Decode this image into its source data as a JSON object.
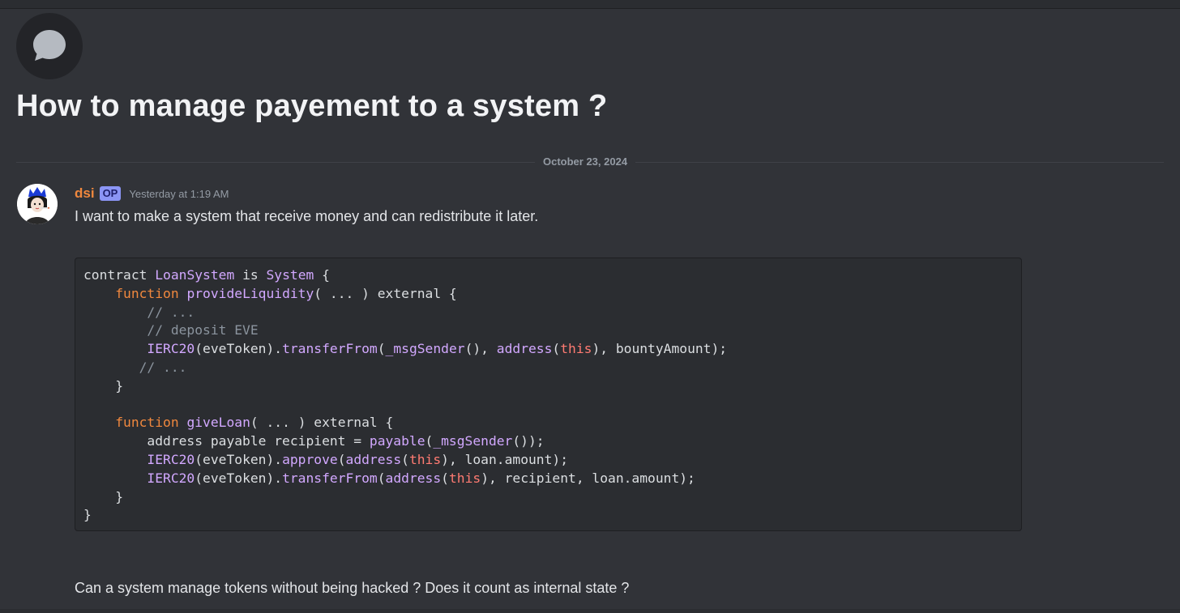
{
  "thread": {
    "title": "How to manage payement to a system ?",
    "icon": "chat-bubble-icon"
  },
  "divider": {
    "date": "October 23, 2024"
  },
  "message": {
    "author": "dsi",
    "badge": "OP",
    "timestamp": "Yesterday at 1:19 AM",
    "text_intro": "I want to make a system that receive money and can redistribute it later.",
    "text_question": "Can a system manage tokens without being hacked ? Does it count as internal state ?"
  },
  "code": {
    "lines": [
      [
        {
          "t": "contract "
        },
        {
          "t": "LoanSystem",
          "c": "fn"
        },
        {
          "t": " is "
        },
        {
          "t": "System",
          "c": "fn"
        },
        {
          "t": " {"
        }
      ],
      [
        {
          "t": "    "
        },
        {
          "t": "function",
          "c": "kw"
        },
        {
          "t": " "
        },
        {
          "t": "provideLiquidity",
          "c": "fn"
        },
        {
          "t": "( ... ) external {"
        }
      ],
      [
        {
          "t": "        "
        },
        {
          "t": "// ...",
          "c": "cm"
        }
      ],
      [
        {
          "t": "        "
        },
        {
          "t": "// deposit EVE",
          "c": "cm"
        }
      ],
      [
        {
          "t": "        "
        },
        {
          "t": "IERC20",
          "c": "fn"
        },
        {
          "t": "(eveToken)."
        },
        {
          "t": "transferFrom",
          "c": "fn"
        },
        {
          "t": "("
        },
        {
          "t": "_msgSender",
          "c": "fn"
        },
        {
          "t": "(), "
        },
        {
          "t": "address",
          "c": "fn"
        },
        {
          "t": "("
        },
        {
          "t": "this",
          "c": "th"
        },
        {
          "t": "), bountyAmount);"
        }
      ],
      [
        {
          "t": "       "
        },
        {
          "t": "// ...",
          "c": "cm"
        }
      ],
      [
        {
          "t": "    }"
        }
      ],
      [
        {
          "t": ""
        }
      ],
      [
        {
          "t": "    "
        },
        {
          "t": "function",
          "c": "kw"
        },
        {
          "t": " "
        },
        {
          "t": "giveLoan",
          "c": "fn"
        },
        {
          "t": "( ... ) external {"
        }
      ],
      [
        {
          "t": "        address payable recipient = "
        },
        {
          "t": "payable",
          "c": "fn"
        },
        {
          "t": "("
        },
        {
          "t": "_msgSender",
          "c": "fn"
        },
        {
          "t": "());"
        }
      ],
      [
        {
          "t": "        "
        },
        {
          "t": "IERC20",
          "c": "fn"
        },
        {
          "t": "(eveToken)."
        },
        {
          "t": "approve",
          "c": "fn"
        },
        {
          "t": "("
        },
        {
          "t": "address",
          "c": "fn"
        },
        {
          "t": "("
        },
        {
          "t": "this",
          "c": "th"
        },
        {
          "t": "), loan.amount);"
        }
      ],
      [
        {
          "t": "        "
        },
        {
          "t": "IERC20",
          "c": "fn"
        },
        {
          "t": "(eveToken)."
        },
        {
          "t": "transferFrom",
          "c": "fn"
        },
        {
          "t": "("
        },
        {
          "t": "address",
          "c": "fn"
        },
        {
          "t": "("
        },
        {
          "t": "this",
          "c": "th"
        },
        {
          "t": "), recipient, loan.amount);"
        }
      ],
      [
        {
          "t": "    }"
        }
      ],
      [
        {
          "t": "}"
        }
      ]
    ]
  },
  "colors": {
    "background": "#313338",
    "username": "#f0883e",
    "keyword": "#f0883e",
    "function": "#d2a8ff",
    "this": "#ff7b72",
    "comment": "#8b949e"
  }
}
